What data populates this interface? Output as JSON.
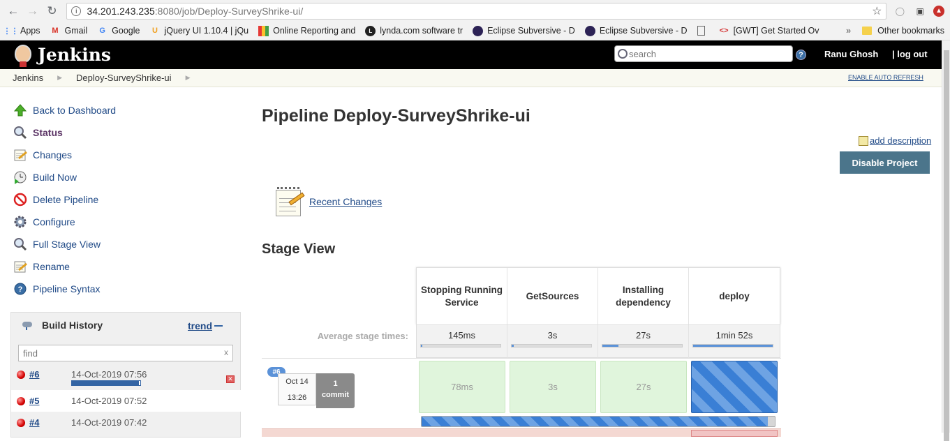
{
  "browser": {
    "url_host": "34.201.243.235",
    "url_path": ":8080/job/Deploy-SurveyShrike-ui/",
    "bookmarks": [
      {
        "label": "Apps",
        "icon": "apps-grid-icon"
      },
      {
        "label": "Gmail",
        "icon": "gmail-icon"
      },
      {
        "label": "Google",
        "icon": "google-icon"
      },
      {
        "label": "jQuery UI 1.10.4 | jQu",
        "icon": "jquery-icon"
      },
      {
        "label": "Online Reporting and",
        "icon": "chart-icon"
      },
      {
        "label": "lynda.com software tr",
        "icon": "lynda-icon"
      },
      {
        "label": "Eclipse Subversive - D",
        "icon": "eclipse-icon"
      },
      {
        "label": "Eclipse Subversive - D",
        "icon": "eclipse-icon"
      },
      {
        "label": "",
        "icon": "document-icon"
      },
      {
        "label": "[GWT] Get Started Ov",
        "icon": "gwt-icon"
      }
    ],
    "more": "»",
    "other_bookmarks": "Other bookmarks"
  },
  "header": {
    "logo_text": "Jenkins",
    "search_placeholder": "search",
    "help": "?",
    "user": "Ranu Ghosh",
    "logout": "| log out"
  },
  "breadcrumb": {
    "items": [
      "Jenkins",
      "Deploy-SurveyShrike-ui"
    ],
    "auto_refresh": "ENABLE AUTO REFRESH"
  },
  "sidebar": {
    "tasks": [
      {
        "label": "Back to Dashboard",
        "icon": "up-arrow-icon"
      },
      {
        "label": "Status",
        "icon": "magnifier-icon"
      },
      {
        "label": "Changes",
        "icon": "notepad-icon"
      },
      {
        "label": "Build Now",
        "icon": "clock-play-icon"
      },
      {
        "label": "Delete Pipeline",
        "icon": "no-entry-icon"
      },
      {
        "label": "Configure",
        "icon": "gear-icon"
      },
      {
        "label": "Full Stage View",
        "icon": "magnifier-icon"
      },
      {
        "label": "Rename",
        "icon": "notepad-icon"
      },
      {
        "label": "Pipeline Syntax",
        "icon": "help-icon"
      }
    ]
  },
  "build_history": {
    "title": "Build History",
    "trend": "trend",
    "find_placeholder": "find",
    "builds": [
      {
        "number": "#6",
        "date": "14-Oct-2019 07:56",
        "in_progress": true,
        "progress": 0.98
      },
      {
        "number": "#5",
        "date": "14-Oct-2019 07:52",
        "in_progress": false
      },
      {
        "number": "#4",
        "date": "14-Oct-2019 07:42",
        "in_progress": false
      }
    ]
  },
  "main": {
    "title": "Pipeline Deploy-SurveyShrike-ui",
    "add_description": "add description",
    "disable_button": "Disable Project",
    "recent_changes": "Recent Changes",
    "stage_view_title": "Stage View"
  },
  "stage_view": {
    "avg_label": "Average stage times:",
    "stages": [
      {
        "name": "Stopping Running Service",
        "avg": "145ms",
        "avg_fill": 0.02
      },
      {
        "name": "GetSources",
        "avg": "3s",
        "avg_fill": 0.03
      },
      {
        "name": "Installing dependency",
        "avg": "27s",
        "avg_fill": 0.2
      },
      {
        "name": "deploy",
        "avg": "1min 52s",
        "avg_fill": 1.0
      }
    ],
    "run": {
      "badge": "#6",
      "date": "Oct 14",
      "time": "13:26",
      "commit_count": "1",
      "commit_label": "commit",
      "cells": [
        "78ms",
        "3s",
        "27s",
        ""
      ],
      "progress": 0.98
    }
  }
}
